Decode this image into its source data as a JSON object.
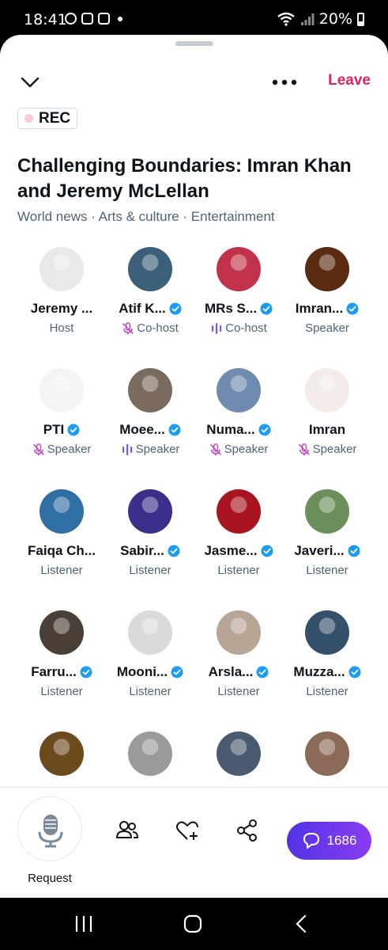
{
  "status": {
    "time": "18:41",
    "battery": "20%"
  },
  "header": {
    "leave_label": "Leave",
    "rec_label": "REC"
  },
  "space": {
    "title": "Challenging Boundaries: Imran Khan and Jeremy McLellan",
    "topics": "World news · Arts & culture · Entertainment"
  },
  "participants": [
    {
      "name": "Jeremy ...",
      "role": "Host",
      "verified": false,
      "role_icon": "none",
      "avatar_color": "#e9e9e9"
    },
    {
      "name": "Atif K...",
      "role": "Co-host",
      "verified": true,
      "role_icon": "mic-muted-icon",
      "avatar_color": "#3c5f7a"
    },
    {
      "name": "MRs S...",
      "role": "Co-host",
      "verified": true,
      "role_icon": "speaking-bars-icon",
      "avatar_color": "#c2334b"
    },
    {
      "name": "Imran...",
      "role": "Speaker",
      "verified": true,
      "role_icon": "none",
      "avatar_color": "#5a2b10"
    },
    {
      "name": "PTI",
      "role": "Speaker",
      "verified": true,
      "role_icon": "mic-muted-icon",
      "avatar_color": "#f4f4f4"
    },
    {
      "name": "Moee...",
      "role": "Speaker",
      "verified": true,
      "role_icon": "speaking-bars-icon",
      "avatar_color": "#7b6a5e"
    },
    {
      "name": "Numa...",
      "role": "Speaker",
      "verified": true,
      "role_icon": "mic-muted-icon",
      "avatar_color": "#6f8cb0"
    },
    {
      "name": "Imran",
      "role": "Speaker",
      "verified": false,
      "role_icon": "mic-muted-icon",
      "avatar_color": "#f3ece8"
    },
    {
      "name": "Faiqa Ch...",
      "role": "Listener",
      "verified": false,
      "role_icon": "none",
      "avatar_color": "#2f6fa4"
    },
    {
      "name": "Sabir...",
      "role": "Listener",
      "verified": true,
      "role_icon": "none",
      "avatar_color": "#3a2f8a"
    },
    {
      "name": "Jasme...",
      "role": "Listener",
      "verified": true,
      "role_icon": "none",
      "avatar_color": "#a8141f"
    },
    {
      "name": "Javeri...",
      "role": "Listener",
      "verified": true,
      "role_icon": "none",
      "avatar_color": "#6a8f5b"
    },
    {
      "name": "Farru...",
      "role": "Listener",
      "verified": true,
      "role_icon": "none",
      "avatar_color": "#4a4038"
    },
    {
      "name": "Mooni...",
      "role": "Listener",
      "verified": true,
      "role_icon": "none",
      "avatar_color": "#dadada"
    },
    {
      "name": "Arsla...",
      "role": "Listener",
      "verified": true,
      "role_icon": "none",
      "avatar_color": "#b7a596"
    },
    {
      "name": "Muzza...",
      "role": "Listener",
      "verified": true,
      "role_icon": "none",
      "avatar_color": "#34506b"
    },
    {
      "name": "",
      "role": "",
      "verified": false,
      "role_icon": "none",
      "avatar_color": "#6b4a1e"
    },
    {
      "name": "",
      "role": "",
      "verified": false,
      "role_icon": "none",
      "avatar_color": "#9a9a9a"
    },
    {
      "name": "",
      "role": "",
      "verified": false,
      "role_icon": "none",
      "avatar_color": "#4a5a70"
    },
    {
      "name": "",
      "role": "",
      "verified": false,
      "role_icon": "none",
      "avatar_color": "#8c6a58"
    }
  ],
  "bottom": {
    "request_label": "Request",
    "chat_count": "1686"
  },
  "colors": {
    "leave": "#e0245e",
    "verified": "#1d9bf0",
    "muted": "#c13ec6",
    "speaking": "#7856ff",
    "chat_gradient_start": "#5233e6",
    "chat_gradient_end": "#8a3cf0"
  }
}
